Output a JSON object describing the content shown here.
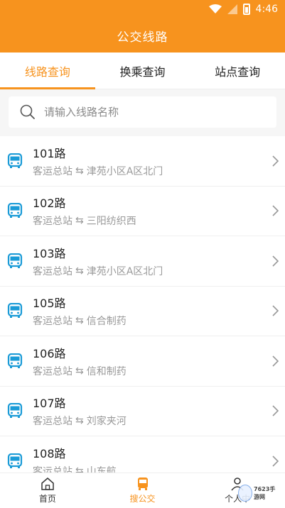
{
  "status_bar": {
    "time": "4:46",
    "icons": [
      "wifi-icon",
      "signal-icon",
      "battery-icon"
    ]
  },
  "header": {
    "title": "公交线路"
  },
  "tabs": [
    {
      "label": "线路查询",
      "active": true
    },
    {
      "label": "换乘查询",
      "active": false
    },
    {
      "label": "站点查询",
      "active": false
    }
  ],
  "search": {
    "placeholder": "请输入线路名称",
    "value": ""
  },
  "routes": [
    {
      "name": "101路",
      "from": "客运总站",
      "to": "津苑小区A区北门"
    },
    {
      "name": "102路",
      "from": "客运总站",
      "to": "三阳纺织西"
    },
    {
      "name": "103路",
      "from": "客运总站",
      "to": "津苑小区A区北门"
    },
    {
      "name": "105路",
      "from": "客运总站",
      "to": "信合制药"
    },
    {
      "name": "106路",
      "from": "客运总站",
      "to": "信和制药"
    },
    {
      "name": "107路",
      "from": "客运总站",
      "to": "刘家夹河"
    },
    {
      "name": "108路",
      "from": "客运总站",
      "to": "山东航"
    }
  ],
  "route_separator": "⇆",
  "bottom_nav": [
    {
      "label": "首页",
      "icon": "home-icon",
      "active": false
    },
    {
      "label": "搜公交",
      "icon": "bus-icon",
      "active": true
    },
    {
      "label": "个人中",
      "icon": "person-icon",
      "active": false
    }
  ],
  "watermark": {
    "text": "7623手游网"
  },
  "colors": {
    "accent": "#f7931e",
    "bus_icon": "#1a9bd7",
    "muted": "#999999"
  }
}
